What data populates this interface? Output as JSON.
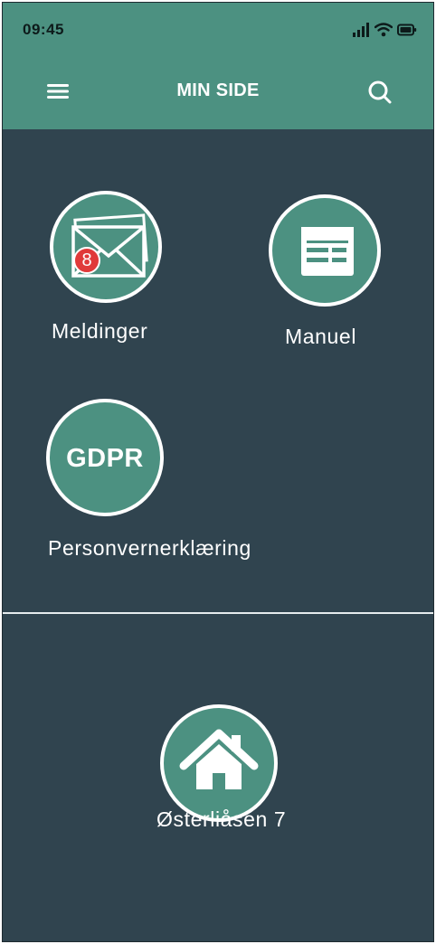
{
  "status_bar": {
    "time": "09:45",
    "icons": [
      "signal-icon",
      "wifi-icon",
      "battery-icon"
    ]
  },
  "header": {
    "title": "MIN SIDE",
    "menu_icon": "menu-icon",
    "search_icon": "search-icon"
  },
  "tiles": [
    {
      "label": "Meldinger",
      "icon": "envelope-icon",
      "badge": "8"
    },
    {
      "label": "Manuel",
      "icon": "manual-icon"
    },
    {
      "label": "Personvernerklæring",
      "icon_text": "GDPR"
    }
  ],
  "property": {
    "label": "Østerliåsen 7",
    "icon": "house-icon"
  },
  "colors": {
    "primary": "#4c9181",
    "background": "#30444f",
    "badge": "#e03a3a",
    "text": "#ffffff"
  }
}
